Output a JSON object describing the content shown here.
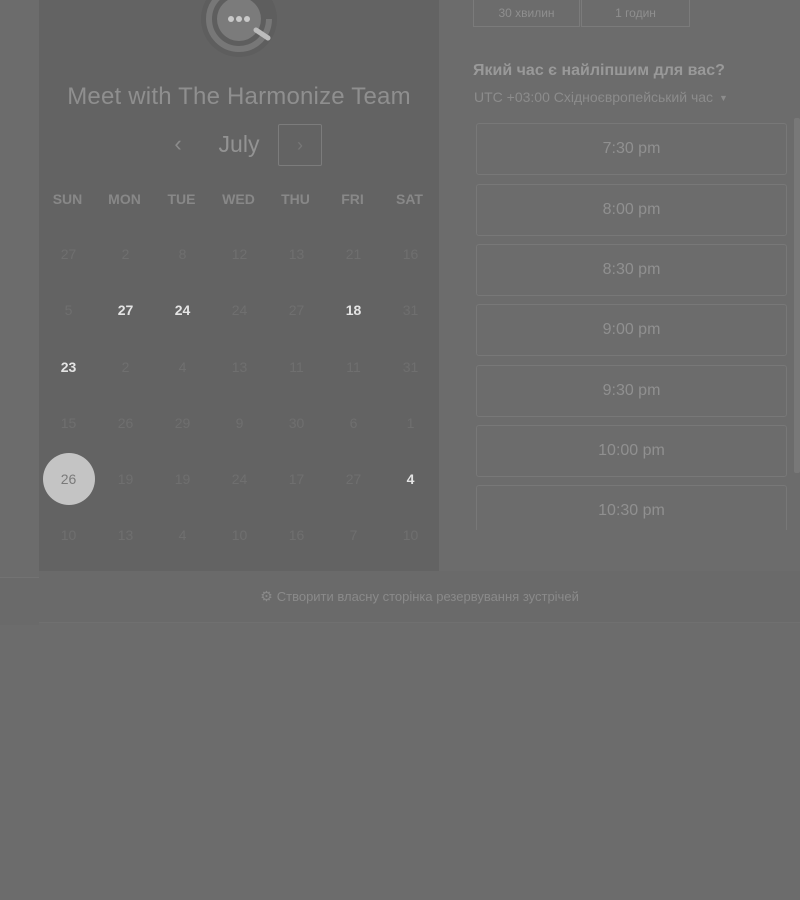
{
  "calendar": {
    "title": "Meet with The Harmonize Team",
    "month": "July",
    "prev_label": "‹",
    "next_label": "›",
    "weekdays": [
      "SUN",
      "MON",
      "TUE",
      "WED",
      "THU",
      "FRI",
      "SAT"
    ],
    "weeks": [
      [
        {
          "d": "27",
          "s": "unavailable"
        },
        {
          "d": "2",
          "s": "unavailable"
        },
        {
          "d": "8",
          "s": "unavailable"
        },
        {
          "d": "12",
          "s": "unavailable"
        },
        {
          "d": "13",
          "s": "unavailable"
        },
        {
          "d": "21",
          "s": "unavailable"
        },
        {
          "d": "16",
          "s": "unavailable"
        }
      ],
      [
        {
          "d": "5",
          "s": "unavailable"
        },
        {
          "d": "27",
          "s": "available"
        },
        {
          "d": "24",
          "s": "available"
        },
        {
          "d": "24",
          "s": "unavailable"
        },
        {
          "d": "27",
          "s": "unavailable"
        },
        {
          "d": "18",
          "s": "available"
        },
        {
          "d": "31",
          "s": "unavailable"
        }
      ],
      [
        {
          "d": "23",
          "s": "available"
        },
        {
          "d": "2",
          "s": "unavailable"
        },
        {
          "d": "4",
          "s": "unavailable"
        },
        {
          "d": "13",
          "s": "unavailable"
        },
        {
          "d": "11",
          "s": "unavailable"
        },
        {
          "d": "11",
          "s": "unavailable"
        },
        {
          "d": "31",
          "s": "unavailable"
        }
      ],
      [
        {
          "d": "15",
          "s": "unavailable"
        },
        {
          "d": "26",
          "s": "unavailable"
        },
        {
          "d": "29",
          "s": "unavailable"
        },
        {
          "d": "9",
          "s": "unavailable"
        },
        {
          "d": "30",
          "s": "unavailable"
        },
        {
          "d": "6",
          "s": "unavailable"
        },
        {
          "d": "1",
          "s": "unavailable"
        }
      ],
      [
        {
          "d": "26",
          "s": "selected"
        },
        {
          "d": "19",
          "s": "unavailable"
        },
        {
          "d": "19",
          "s": "unavailable"
        },
        {
          "d": "24",
          "s": "unavailable"
        },
        {
          "d": "17",
          "s": "unavailable"
        },
        {
          "d": "27",
          "s": "unavailable"
        },
        {
          "d": "4",
          "s": "available"
        }
      ],
      [
        {
          "d": "10",
          "s": "unavailable"
        },
        {
          "d": "13",
          "s": "unavailable"
        },
        {
          "d": "4",
          "s": "unavailable"
        },
        {
          "d": "10",
          "s": "unavailable"
        },
        {
          "d": "16",
          "s": "unavailable"
        },
        {
          "d": "7",
          "s": "unavailable"
        },
        {
          "d": "10",
          "s": "unavailable"
        }
      ]
    ]
  },
  "durations": [
    "30 хвилин",
    "1 годин"
  ],
  "schedule": {
    "question": "Який час є найліпшим для вас?",
    "timezone": "UTC +03:00 Східноєвропейський час",
    "slots": [
      "7:30 pm",
      "8:00 pm",
      "8:30 pm",
      "9:00 pm",
      "9:30 pm",
      "10:00 pm",
      "10:30 pm"
    ]
  },
  "footer": {
    "link_text": "Створити власну сторінка резервування зустрічей"
  },
  "colors": {
    "overlay_bg": "#6c6c6c",
    "panel_bg": "#636363",
    "selected_day": "#c4c4c4"
  }
}
